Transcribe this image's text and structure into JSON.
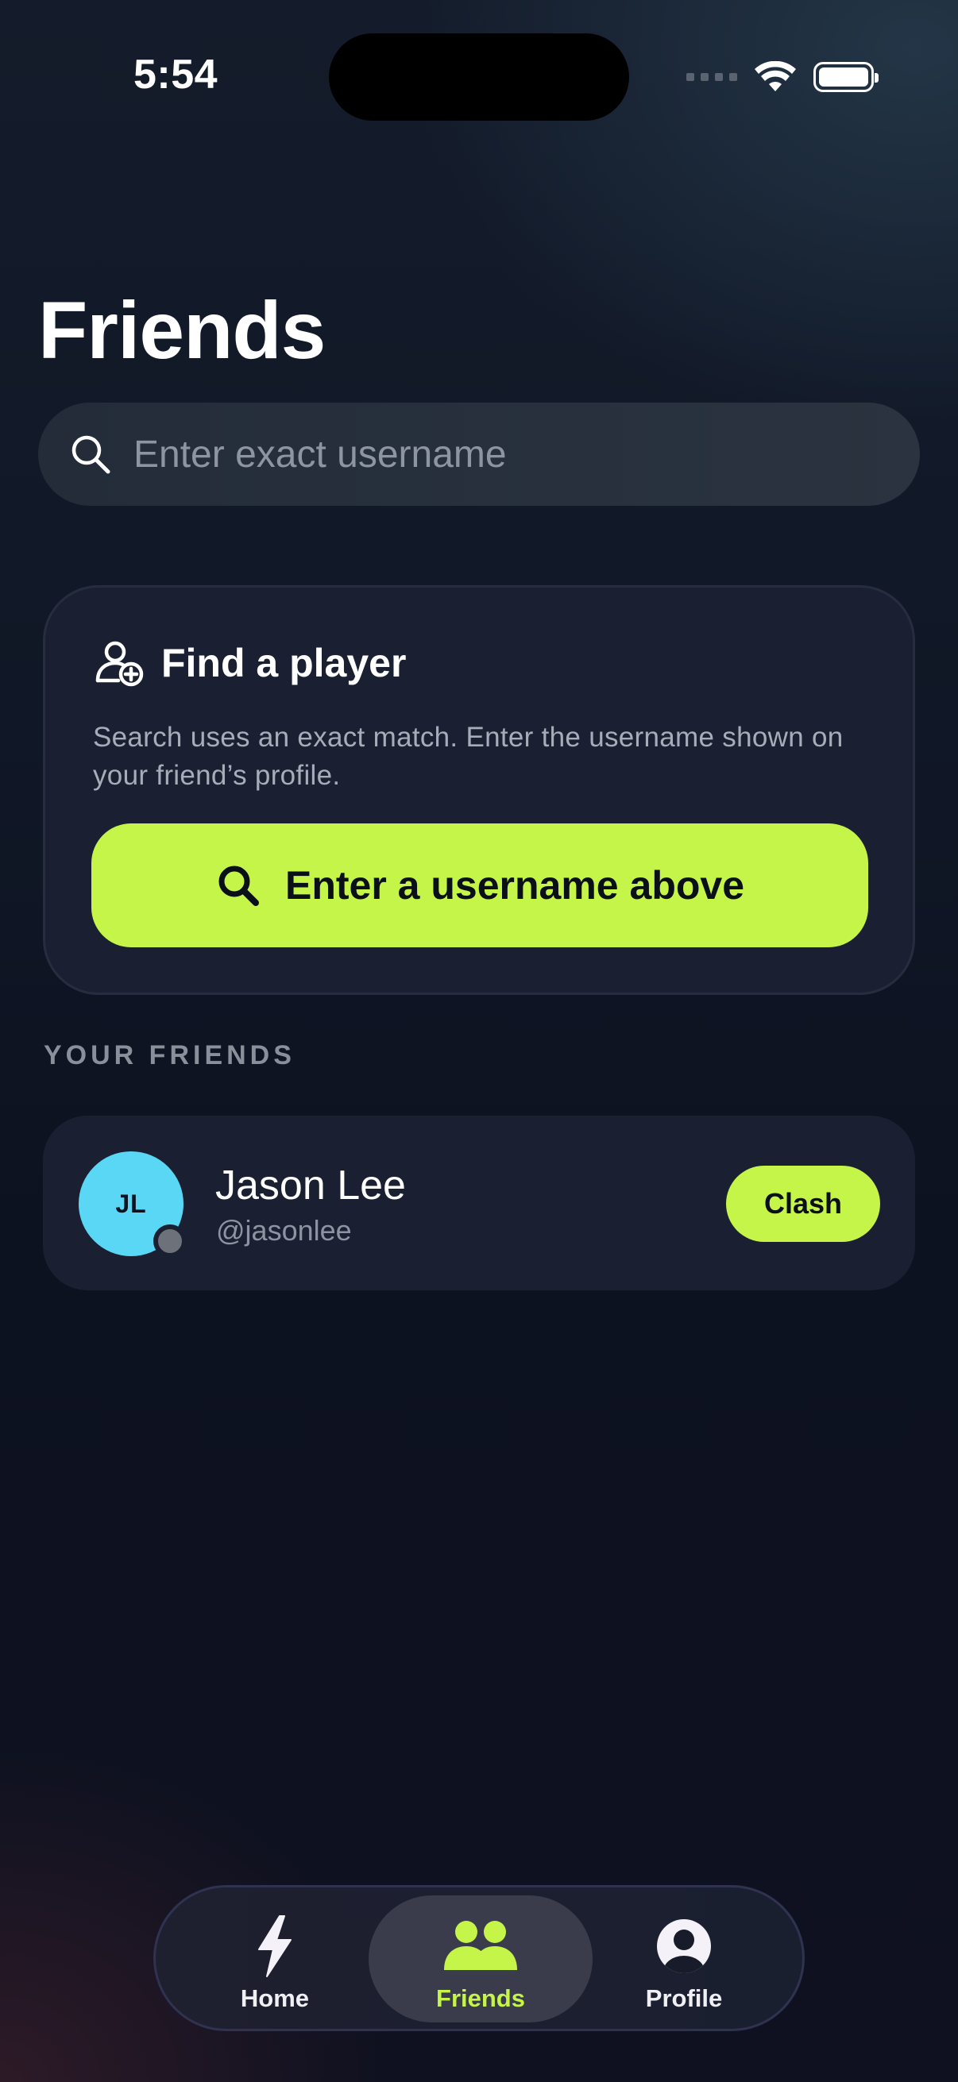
{
  "status_bar": {
    "time": "5:54"
  },
  "header": {
    "title": "Friends"
  },
  "search": {
    "placeholder": "Enter exact username",
    "value": ""
  },
  "find_card": {
    "title": "Find a player",
    "description": "Search uses an exact match. Enter the username shown on your friend’s profile.",
    "button_label": "Enter a username above"
  },
  "friends_section": {
    "label": "YOUR FRIENDS",
    "friends": [
      {
        "initials": "JL",
        "name": "Jason Lee",
        "handle": "@jasonlee",
        "action_label": "Clash",
        "avatar_color": "#5ad7f5"
      }
    ]
  },
  "tab_bar": {
    "tabs": [
      {
        "label": "Home",
        "icon": "bolt-icon"
      },
      {
        "label": "Friends",
        "icon": "people-icon",
        "active": true
      },
      {
        "label": "Profile",
        "icon": "person-circle-icon"
      }
    ]
  },
  "colors": {
    "accent": "#c6f54a",
    "background": "#0d1220",
    "card": "#1a2032"
  }
}
